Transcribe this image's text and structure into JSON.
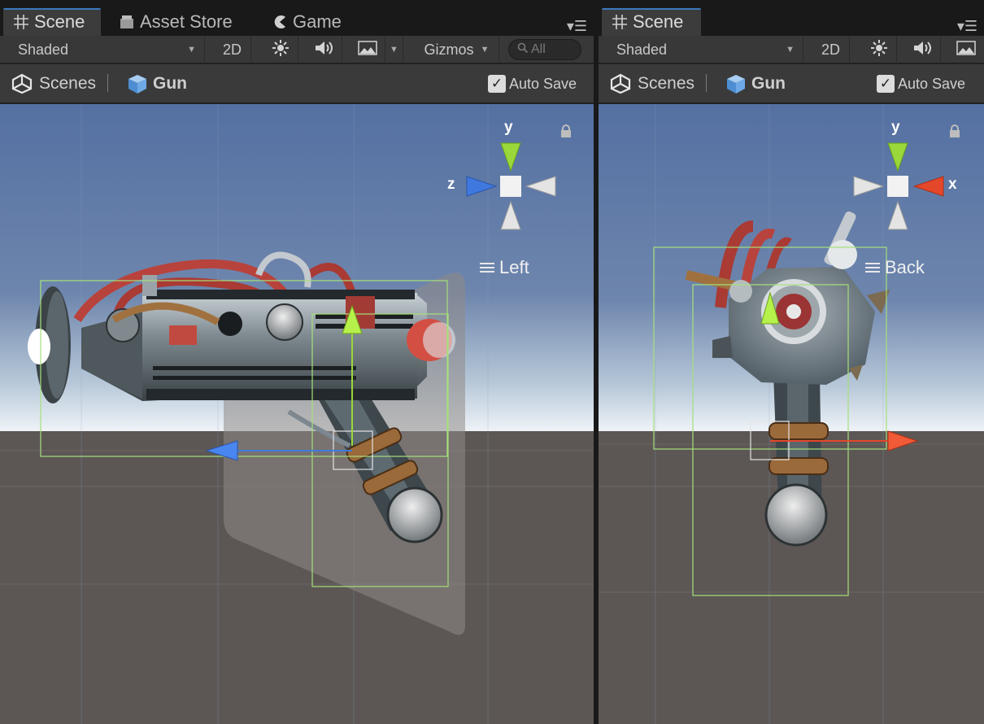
{
  "left_panel": {
    "tabs": [
      {
        "label": "Scene",
        "icon": "grid-icon",
        "active": true
      },
      {
        "label": "Asset Store",
        "icon": "store-icon",
        "active": false
      },
      {
        "label": "Game",
        "icon": "pacman-icon",
        "active": false
      }
    ],
    "toolbar": {
      "shading_mode": "Shaded",
      "mode_2d": "2D",
      "gizmos": "Gizmos",
      "search_placeholder": "All"
    },
    "breadcrumb": {
      "root": "Scenes",
      "current": "Gun",
      "auto_save": "Auto Save",
      "auto_save_checked": true
    },
    "viewport": {
      "view_label": "Left",
      "gizmo_axes": [
        "y",
        "z"
      ]
    }
  },
  "right_panel": {
    "tabs": [
      {
        "label": "Scene",
        "icon": "grid-icon",
        "active": true
      }
    ],
    "toolbar": {
      "shading_mode": "Shaded",
      "mode_2d": "2D"
    },
    "breadcrumb": {
      "root": "Scenes",
      "current": "Gun",
      "auto_save": "Auto Save",
      "auto_save_checked": true
    },
    "viewport": {
      "view_label": "Back",
      "gizmo_axes": [
        "y",
        "x"
      ]
    }
  },
  "colors": {
    "sky_top": "#5470a2",
    "sky_horizon": "#eef3f7",
    "ground": "#5c5755",
    "tab_accent": "#3a79bb",
    "axis_x": "#e4472a",
    "axis_y": "#9ad73a",
    "axis_z": "#3f79e0",
    "bounds": "#a6e07a"
  }
}
